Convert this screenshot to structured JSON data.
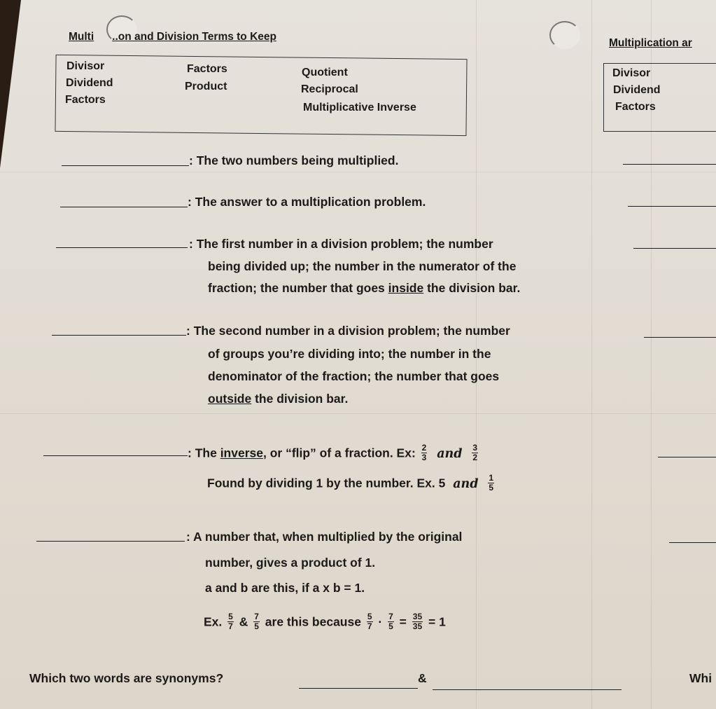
{
  "left_sheet": {
    "title": "Multip[…]on and Division Terms to Keep",
    "title_visible_start": "Multi",
    "title_visible_end": "..on and Division Terms to Keep",
    "word_bank": {
      "col1": [
        "Divisor",
        "Dividend",
        "Factors"
      ],
      "col2": [
        "Factors",
        "Product"
      ],
      "col3": [
        "Quotient",
        "Reciprocal",
        "Multiplicative Inverse"
      ]
    },
    "definitions": [
      {
        "lines": [
          "The two numbers being multiplied."
        ]
      },
      {
        "lines": [
          "The answer to a multiplication problem."
        ]
      },
      {
        "lines": [
          "The first number in a division problem; the number",
          "being divided up; the number in the numerator of the",
          "fraction; the number that goes ",
          "inside",
          " the division bar."
        ]
      },
      {
        "lines": [
          "The second number in a division problem; the number",
          "of groups you’re dividing into;  the number in the",
          "denominator of the fraction; the number that goes",
          "outside",
          " the division bar."
        ]
      },
      {
        "line1_pre": "The ",
        "line1_underlined": "inverse",
        "line1_post": ", or “flip” of a fraction.  Ex:",
        "ex1_a": {
          "num": "2",
          "den": "3"
        },
        "ex1_b": {
          "num": "3",
          "den": "2"
        },
        "and": "and",
        "line2": "Found by dividing 1 by the number.  Ex.  5",
        "ex2_b": {
          "num": "1",
          "den": "5"
        }
      },
      {
        "line1": "A number that, when multiplied by the original",
        "line2": "number, gives a product of 1.",
        "line3": "a  and  b  are this, if a x b = 1.",
        "line4_ex": "Ex.",
        "f1": {
          "num": "5",
          "den": "7"
        },
        "amp": "&",
        "f2": {
          "num": "7",
          "den": "5"
        },
        "because": "are this because",
        "f3": {
          "num": "5",
          "den": "7"
        },
        "dot": "·",
        "f4": {
          "num": "7",
          "den": "5"
        },
        "eq": "=",
        "f5": {
          "num": "35",
          "den": "35"
        },
        "result": "= 1"
      }
    ],
    "colon": ":",
    "synonym_question": "Which two words are synonyms?",
    "synonym_amp": "&"
  },
  "right_sheet": {
    "title": "Multiplication ar",
    "word_bank": [
      "Divisor",
      "Dividend",
      "Factors"
    ],
    "partial_question": "Whi"
  }
}
